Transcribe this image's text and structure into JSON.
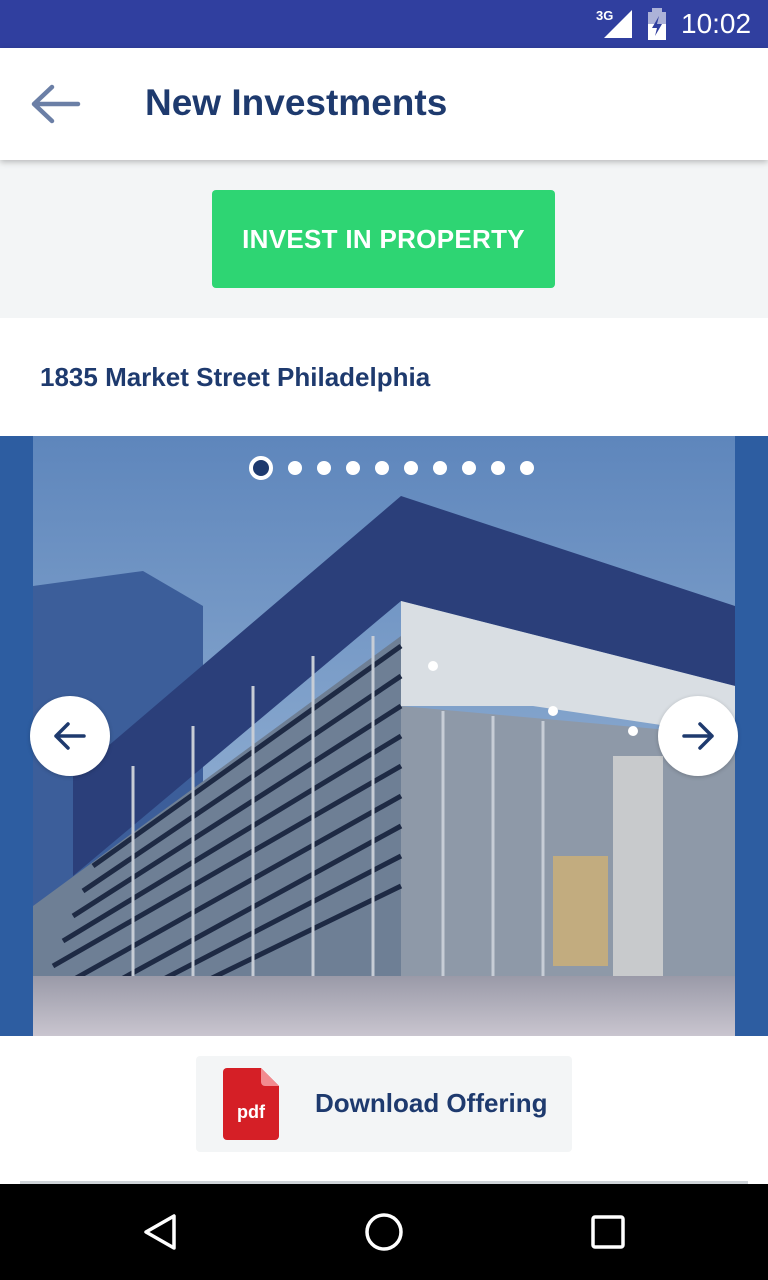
{
  "status_bar": {
    "network": "3G",
    "time": "10:02"
  },
  "app_bar": {
    "back_icon": "arrow-left-icon",
    "title": "New Investments"
  },
  "invest": {
    "button_label": "INVEST IN PROPERTY",
    "color": "#2ED573"
  },
  "property": {
    "address": "1835 Market Street Philadelphia"
  },
  "carousel": {
    "slide_count": 10,
    "active_index": 0,
    "prev_icon": "arrow-left-icon",
    "next_icon": "arrow-right-icon",
    "image": "modern-building-photo"
  },
  "download": {
    "icon": "pdf-file-icon",
    "icon_text": "pdf",
    "label": "Download Offering"
  },
  "navigation": {
    "back": "triangle-back-icon",
    "home": "circle-home-icon",
    "recents": "square-recents-icon"
  },
  "colors": {
    "status_bar": "#303F9F",
    "title_text": "#1E3A6E",
    "carousel_bg": "#2D5DA1"
  }
}
